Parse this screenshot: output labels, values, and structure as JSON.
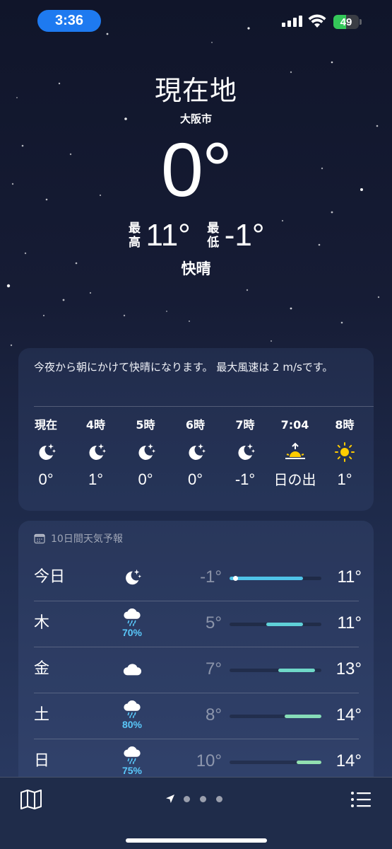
{
  "status_bar": {
    "time": "3:36",
    "battery_percent": 49,
    "battery_label": "49"
  },
  "header": {
    "location_title": "現在地",
    "city": "大阪市",
    "current_temp": "0°",
    "high_label": "最高",
    "high_value": "11°",
    "low_label": "最低",
    "low_value": "-1°",
    "condition": "快晴"
  },
  "hourly": {
    "summary": "今夜から朝にかけて快晴になります。 最大風速は 2 m/sです。",
    "items": [
      {
        "time": "現在",
        "icon": "moon-stars-icon",
        "temp": "0°"
      },
      {
        "time": "4時",
        "icon": "moon-stars-icon",
        "temp": "1°"
      },
      {
        "time": "5時",
        "icon": "moon-stars-icon",
        "temp": "0°"
      },
      {
        "time": "6時",
        "icon": "moon-stars-icon",
        "temp": "0°"
      },
      {
        "time": "7時",
        "icon": "moon-stars-icon",
        "temp": "-1°"
      },
      {
        "time": "7:04",
        "icon": "sunrise-icon",
        "temp": "日の出"
      },
      {
        "time": "8時",
        "icon": "sun-icon",
        "temp": "1°"
      }
    ]
  },
  "daily": {
    "header": "10日間天気予報",
    "range_min": -1,
    "range_max": 14,
    "current_temp_value": 0,
    "days": [
      {
        "day": "今日",
        "icon": "moon-stars-icon",
        "precip": "",
        "low": "-1°",
        "high": "11°",
        "low_value": -1,
        "high_value": 11,
        "bar_color": "#4fc3e8"
      },
      {
        "day": "木",
        "icon": "cloud-rain-icon",
        "precip": "70%",
        "low": "5°",
        "high": "11°",
        "low_value": 5,
        "high_value": 11,
        "bar_color": "#5fd0d8"
      },
      {
        "day": "金",
        "icon": "cloud-icon",
        "precip": "",
        "low": "7°",
        "high": "13°",
        "low_value": 7,
        "high_value": 13,
        "bar_color": "#6fd8c8"
      },
      {
        "day": "土",
        "icon": "cloud-rain-icon",
        "precip": "80%",
        "low": "8°",
        "high": "14°",
        "low_value": 8,
        "high_value": 14,
        "bar_color": "#86dcb8"
      },
      {
        "day": "日",
        "icon": "cloud-rain-icon",
        "precip": "75%",
        "low": "10°",
        "high": "14°",
        "low_value": 10,
        "high_value": 14,
        "bar_color": "#92e0b0"
      }
    ]
  },
  "colors": {
    "time_pill": "#1e7af0",
    "battery_fill": "#34c759",
    "precip": "#5ac8fa",
    "sun": "#ffcc00"
  }
}
